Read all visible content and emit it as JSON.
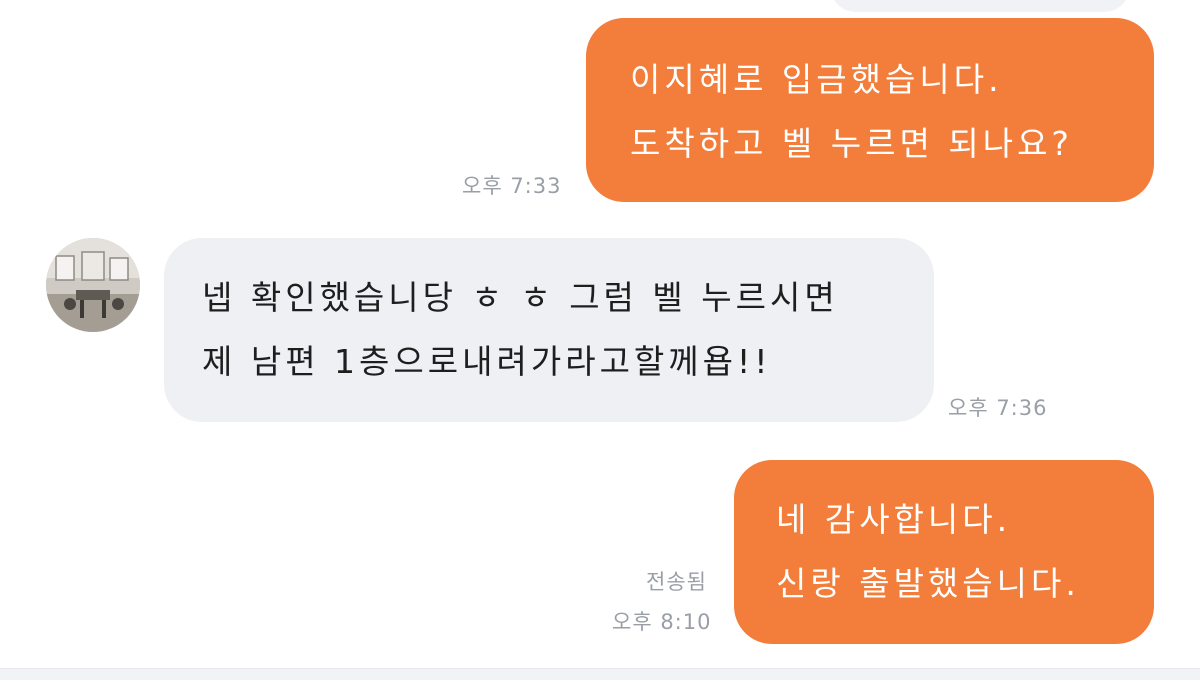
{
  "messages": [
    {
      "direction": "outgoing",
      "lines": [
        "이지혜로 입금했습니다.",
        "도착하고 벨 누르면 되나요?"
      ],
      "time": "오후 7:33"
    },
    {
      "direction": "incoming",
      "lines": [
        "넵 확인했습니당 ㅎ ㅎ 그럼 벨 누르시면",
        "제 남편 1층으로내려가라고할께욥!!"
      ],
      "time": "오후 7:36"
    },
    {
      "direction": "outgoing",
      "lines": [
        "네 감사합니다.",
        "신랑 출발했습니다."
      ],
      "status": "전송됨",
      "time": "오후 8:10"
    }
  ],
  "colors": {
    "outgoing_bubble": "#f37d3a",
    "incoming_bubble": "#eef0f3",
    "meta_text": "#9a9ea6"
  },
  "icons": {
    "avatar": "profile-photo"
  }
}
